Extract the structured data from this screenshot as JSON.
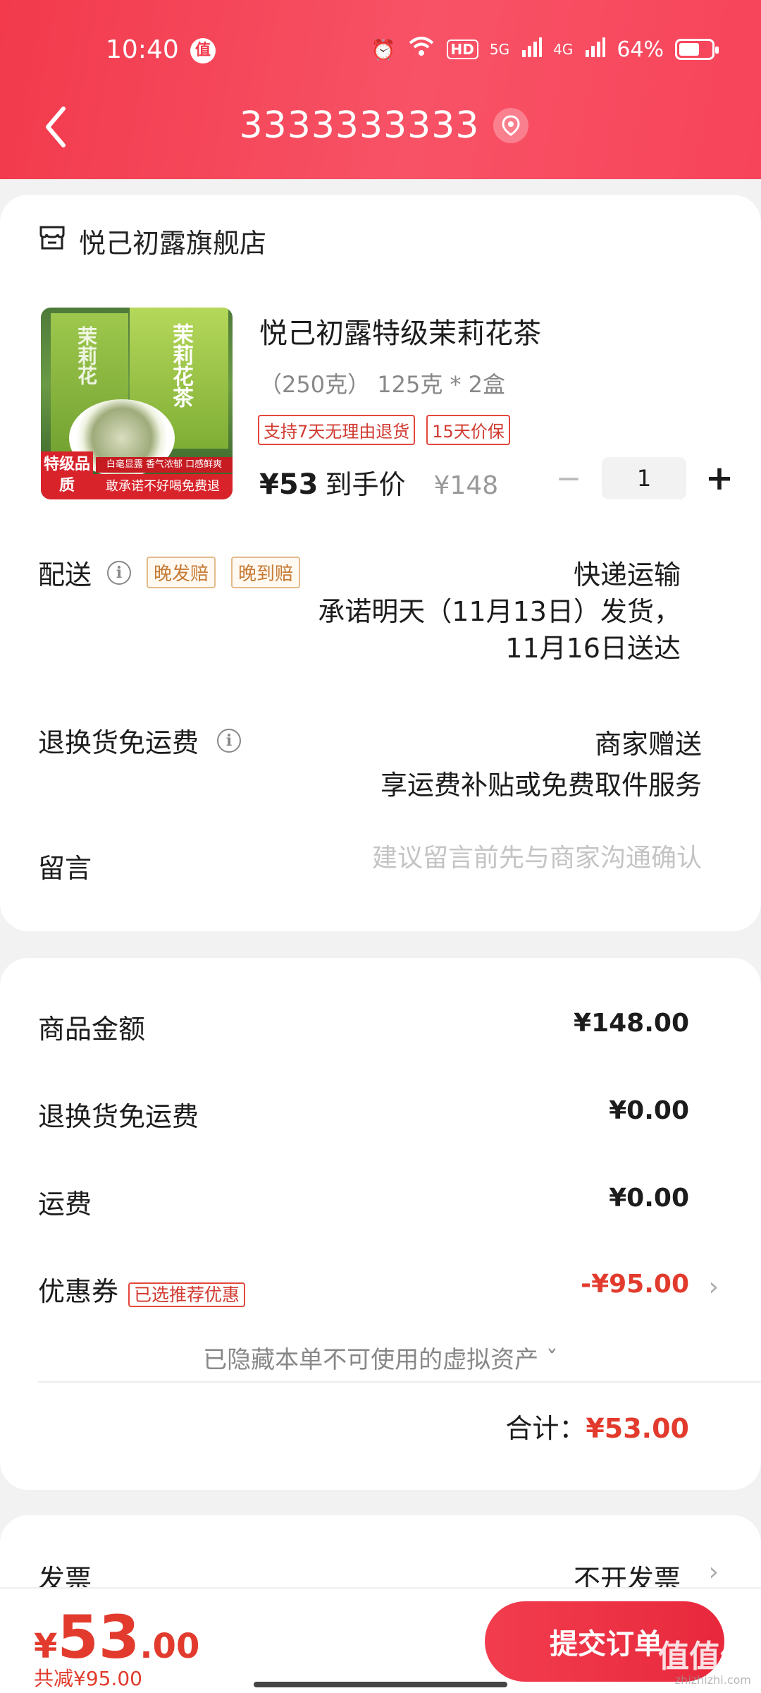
{
  "status_bar": {
    "time": "10:40",
    "zhi": "值",
    "hd": "HD",
    "net1": "5G",
    "net2": "4G",
    "battery": "64%",
    "battery_level": 0.64
  },
  "nav": {
    "back_label": "返回",
    "title": "3333333333"
  },
  "shop": {
    "name": "悦己初露旗舰店"
  },
  "product": {
    "title": "悦己初露特级茉莉花茶",
    "spec": "（250克） 125克 * 2盒",
    "tags": [
      "支持7天无理由退货",
      "15天价保"
    ],
    "price": "¥53",
    "price_label": "到手价",
    "original_price": "¥148",
    "quantity": "1",
    "minus": "−",
    "plus": "+",
    "image_texts": {
      "box_a": "茉莉花",
      "box_b": "茉莉花茶",
      "grade": "特级品质",
      "slogan": "白毫显露 香气浓郁 口感鲜爽",
      "promise": "敢承诺不好喝免费退"
    }
  },
  "delivery": {
    "label": "配送",
    "info": "i",
    "tags": [
      "晚发赔",
      "晚到赔"
    ],
    "method": "快递运输",
    "line1": "承诺明天（11月13日）发货，",
    "line2": "11月16日送达"
  },
  "return_shipping": {
    "label": "退换货免运费",
    "info": "i",
    "value1": "商家赠送",
    "value2": "享运费补贴或免费取件服务"
  },
  "message": {
    "label": "留言",
    "placeholder": "建议留言前先与商家沟通确认"
  },
  "summary": {
    "goods_label": "商品金额",
    "goods_value": "¥148.00",
    "return_label": "退换货免运费",
    "return_value": "¥0.00",
    "shipping_label": "运费",
    "shipping_value": "¥0.00",
    "coupon_label": "优惠券",
    "coupon_tag": "已选推荐优惠",
    "coupon_value": "-¥95.00",
    "chevron": "›",
    "hidden_assets": "已隐藏本单不可使用的虚拟资产 ˇ",
    "total_label": "合计：",
    "total_value": "¥53.00"
  },
  "invoice": {
    "label": "发票",
    "value": "不开发票",
    "chevron": "›"
  },
  "bottom": {
    "yen": "¥",
    "price_int": "53",
    "price_dec": ".00",
    "saved": "共减¥95.00",
    "submit": "提交订单"
  },
  "watermark": {
    "logo": "值值值",
    "site": "zhizhizhi.com"
  },
  "colors": {
    "accent": "#f23a4c",
    "price_red": "#e23b2d",
    "tag_orange": "#c77a32"
  }
}
